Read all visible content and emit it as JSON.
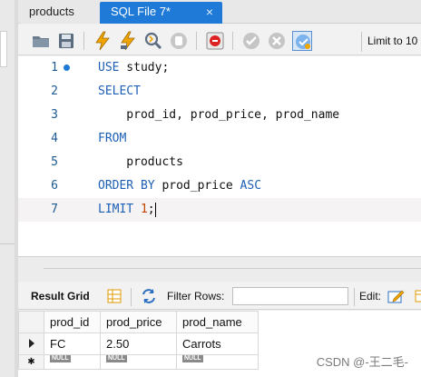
{
  "tabs": [
    {
      "label": "products",
      "active": false
    },
    {
      "label": "SQL File 7*",
      "active": true
    }
  ],
  "tab_close_glyph": "×",
  "toolbar": {
    "icons": [
      "open-folder-icon",
      "save-icon",
      "execute-icon",
      "execute-current-icon",
      "explain-icon",
      "stop-icon",
      "stop-on-error-icon",
      "commit-icon",
      "rollback-icon",
      "autocommit-icon"
    ],
    "limit_label": "Limit to 10"
  },
  "editor": {
    "lines": [
      {
        "number": "1",
        "parts": [
          {
            "t": "USE",
            "k": "kw"
          },
          {
            "t": " study;",
            "k": ""
          }
        ]
      },
      {
        "number": "2",
        "parts": [
          {
            "t": "SELECT",
            "k": "kw"
          }
        ]
      },
      {
        "number": "3",
        "parts": [
          {
            "t": "    prod_id, prod_price, prod_name",
            "k": ""
          }
        ]
      },
      {
        "number": "4",
        "parts": [
          {
            "t": "FROM",
            "k": "kw"
          }
        ]
      },
      {
        "number": "5",
        "parts": [
          {
            "t": "    products",
            "k": ""
          }
        ]
      },
      {
        "number": "6",
        "parts": [
          {
            "t": "ORDER BY",
            "k": "kw"
          },
          {
            "t": " prod_price ",
            "k": ""
          },
          {
            "t": "ASC",
            "k": "kw"
          }
        ]
      },
      {
        "number": "7",
        "parts": [
          {
            "t": "LIMIT",
            "k": "kw"
          },
          {
            "t": " ",
            "k": ""
          },
          {
            "t": "1",
            "k": "num"
          },
          {
            "t": ";",
            "k": ""
          }
        ]
      }
    ]
  },
  "result_bar": {
    "result_grid_label": "Result Grid",
    "filter_rows_label": "Filter Rows:",
    "filter_value": "",
    "edit_label": "Edit:"
  },
  "grid": {
    "columns": [
      "prod_id",
      "prod_price",
      "prod_name"
    ],
    "rows": [
      [
        "FC",
        "2.50",
        "Carrots"
      ]
    ],
    "null_label": "NULL"
  },
  "watermark": "CSDN @-王二毛-",
  "colors": {
    "accent": "#1e7ad6",
    "keyword": "#1d5fb5",
    "number": "#c04400"
  }
}
